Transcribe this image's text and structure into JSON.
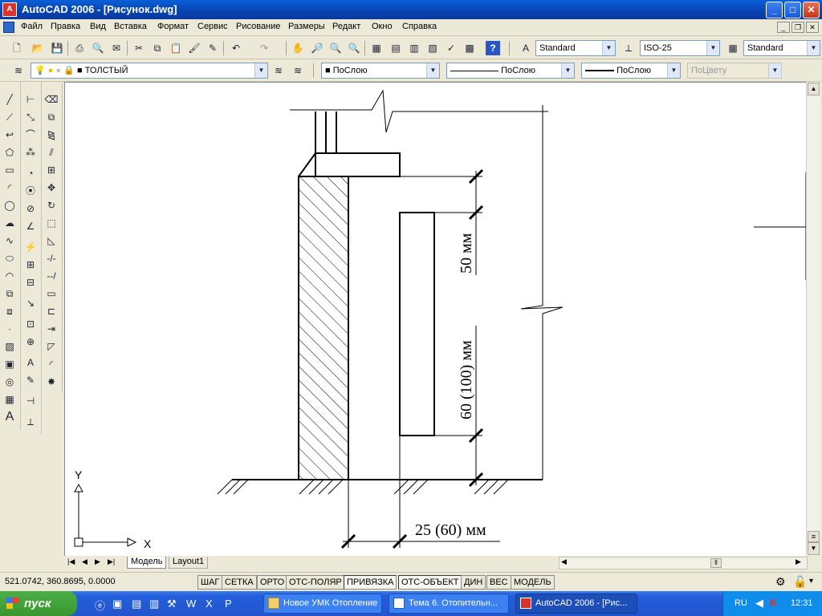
{
  "window": {
    "title": "AutoCAD 2006 - [Рисунок.dwg]",
    "app_icon_text": "A",
    "controls": {
      "minimize": "_",
      "maximize": "□",
      "close": "✕"
    }
  },
  "menu": {
    "items": [
      "Файл",
      "Правка",
      "Вид",
      "Вставка",
      "Формат",
      "Сервис",
      "Рисование",
      "Размеры",
      "Редакт",
      "Окно",
      "Справка"
    ],
    "doc_controls": {
      "minimize": "_",
      "restore": "❐",
      "close": "✕"
    }
  },
  "toolbar_standard": {
    "text_style": "Standard",
    "dim_style": "ISO-25",
    "table_style": "Standard"
  },
  "toolbar_layers": {
    "layer": "ТОЛСТЫЙ",
    "color": "ПоСлою",
    "linetype": "ПоСлою",
    "lineweight": "ПоСлою",
    "plot_style": "ПоЦвету"
  },
  "drawing": {
    "dim_top": "50 мм",
    "dim_side": "60 (100) мм",
    "dim_bottom": "25 (60) мм",
    "ucs_x": "X",
    "ucs_y": "Y"
  },
  "tabs": {
    "model": "Модель",
    "layout1": "Layout1"
  },
  "statusbar": {
    "coords": "521.0742, 360.8695, 0.0000",
    "buttons": [
      "ШАГ",
      "СЕТКА",
      "ОРТО",
      "ОТС-ПОЛЯР",
      "ПРИВЯЗКА",
      "ОТС-ОБЪЕКТ",
      "ДИН",
      "ВЕС",
      "МОДЕЛЬ"
    ]
  },
  "taskbar": {
    "start": "пуск",
    "tasks": [
      "Новое УМК Отопление",
      "Тема 6. Отопительн...",
      "AutoCAD 2006 - [Рис..."
    ],
    "lang": "RU",
    "time": "12:31"
  },
  "colors": {
    "titlebar": "#0a5fd8",
    "workspace": "#ffffff",
    "taskbar": "#245edb",
    "start_button": "#3a962f"
  }
}
